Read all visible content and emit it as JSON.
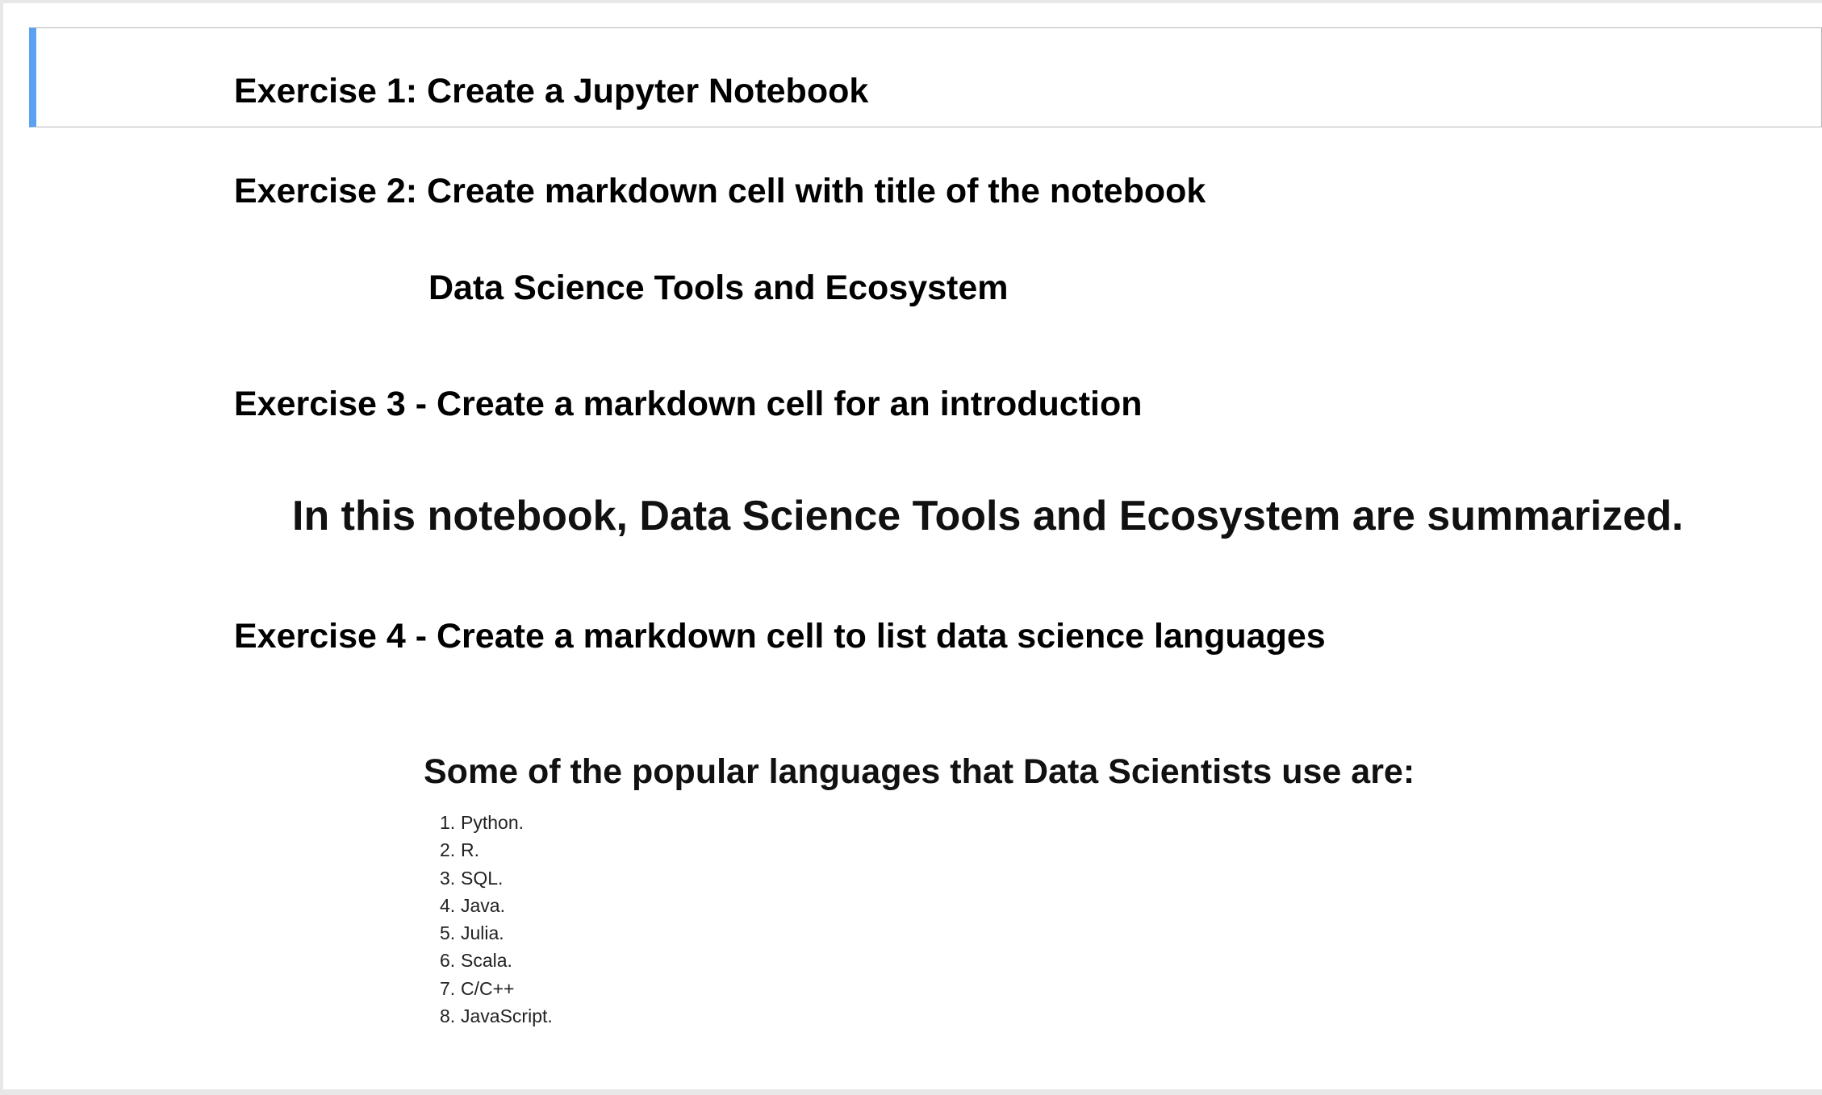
{
  "exercises": {
    "ex1_heading": "Exercise 1: Create a Jupyter Notebook",
    "ex2_heading": "Exercise 2: Create markdown cell with title of the notebook",
    "ex3_heading": "Exercise 3 - Create a markdown cell for an introduction",
    "ex4_heading": "Exercise 4 - Create a markdown cell to list data science languages"
  },
  "notebook_title": "Data Science Tools and Ecosystem",
  "introduction": "In this notebook, Data Science Tools and Ecosystem are summarized.",
  "languages": {
    "heading": "Some of the popular languages that Data Scientists use are:",
    "items": [
      {
        "num": "1.",
        "name": "Python."
      },
      {
        "num": "2.",
        "name": "R."
      },
      {
        "num": "3.",
        "name": "SQL."
      },
      {
        "num": "4.",
        "name": "Java."
      },
      {
        "num": "5.",
        "name": "Julia."
      },
      {
        "num": "6.",
        "name": "Scala."
      },
      {
        "num": "7.",
        "name": "C/C++"
      },
      {
        "num": "8.",
        "name": "JavaScript."
      }
    ]
  },
  "colors": {
    "selected_cell_bar": "#5aa2f0",
    "cell_border": "#b5b5b5",
    "page_background": "#e8e8e8"
  }
}
